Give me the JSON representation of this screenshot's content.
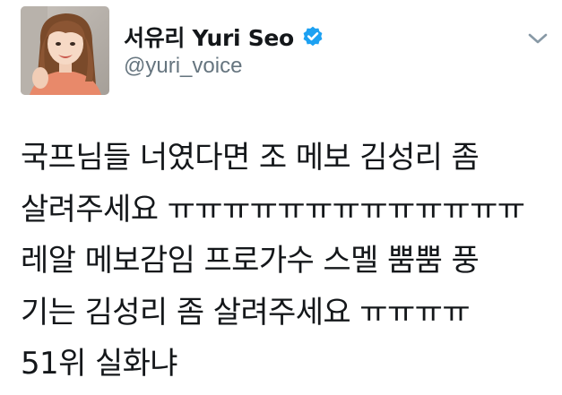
{
  "author": {
    "display_name": "서유리 Yuri Seo",
    "handle": "@yuri_voice",
    "verified": true,
    "verified_color": "#1da1f2"
  },
  "menu": {
    "icon": "chevron-down-icon",
    "color": "#8899a6"
  },
  "tweet": {
    "lines": [
      "국프님들 너였다면 조 메보 김성리 좀",
      "살려주세요 ㅠㅠㅠㅠㅠㅠㅠㅠㅠㅠㅠㅠㅠ",
      "레알 메보감임 프로가수 스멜 뿜뿜 풍",
      "기는 김성리 좀 살려주세요 ㅠㅠㅠㅠ",
      "51위 실화냐"
    ]
  }
}
